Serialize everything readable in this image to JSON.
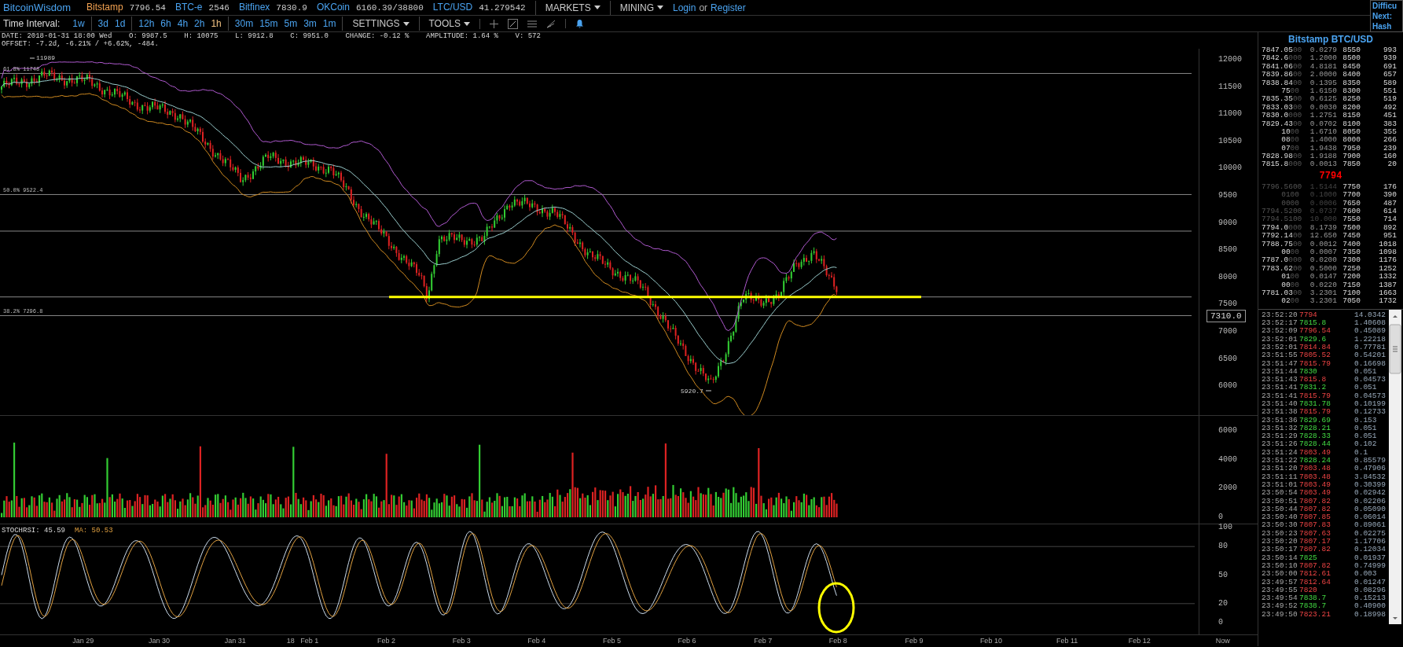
{
  "top_bar": {
    "logo": "BitcoinWisdom",
    "exchanges": [
      {
        "name": "Bitstamp",
        "price": "7796.54",
        "selected": true
      },
      {
        "name": "BTC-e",
        "price": "2546",
        "selected": false
      },
      {
        "name": "Bitfinex",
        "price": "7830.9",
        "selected": false
      },
      {
        "name": "OKCoin",
        "price": "6160.39/38800",
        "selected": false
      },
      {
        "name": "LTC/USD",
        "price": "41.279542",
        "selected": false
      }
    ],
    "menus": [
      "MARKETS",
      "MINING"
    ],
    "login": "Login",
    "or": "or",
    "register": "Register",
    "side_box": [
      "Difficu",
      "Next:",
      "Hash"
    ]
  },
  "toolbar": {
    "label": "Time Interval:",
    "interval_groups": [
      [
        {
          "label": "1w",
          "selected": false
        }
      ],
      [
        {
          "label": "3d",
          "selected": false
        },
        {
          "label": "1d",
          "selected": false
        }
      ],
      [
        {
          "label": "12h",
          "selected": false
        },
        {
          "label": "6h",
          "selected": false
        },
        {
          "label": "4h",
          "selected": false
        },
        {
          "label": "2h",
          "selected": false
        },
        {
          "label": "1h",
          "selected": true
        }
      ],
      [
        {
          "label": "30m",
          "selected": false
        },
        {
          "label": "15m",
          "selected": false
        },
        {
          "label": "5m",
          "selected": false
        },
        {
          "label": "3m",
          "selected": false
        },
        {
          "label": "1m",
          "selected": false
        }
      ]
    ],
    "menus": [
      "SETTINGS",
      "TOOLS"
    ]
  },
  "info_lines": [
    "DATE: 2018-01-31 18:00 Wed    O: 9987.5    H: 10075    L: 9912.8    C: 9951.0    CHANGE: -0.12 %    AMPLITUDE: 1.64 %    V: 572",
    "OFFSET: -7.2d, -6.21% / +6.62%, -484."
  ],
  "price_chart": {
    "fib_levels": [
      "61.8% 11748",
      "50.0% 9522.4",
      "38.2% 7296.8"
    ],
    "annotations": [
      "11989",
      "5920.7"
    ],
    "price_tag": "7310.0",
    "y_ticks": [
      "12000",
      "11500",
      "11000",
      "10500",
      "10000",
      "9500",
      "9000",
      "8500",
      "8000",
      "7500",
      "7000",
      "6500",
      "6000"
    ]
  },
  "volume_chart": {
    "y_ticks": [
      "6000",
      "4000",
      "2000",
      "0"
    ]
  },
  "stoch_chart": {
    "title": "STOCHRSI: 45.59",
    "ma": "MA: 50.53",
    "y_ticks": [
      "100",
      "80",
      "50",
      "20",
      "0"
    ]
  },
  "x_axis": [
    "Jan 29",
    "Jan 30",
    "Jan 31",
    "18",
    "Feb 1",
    "Feb 2",
    "Feb 3",
    "Feb 4",
    "Feb 5",
    "Feb 6",
    "Feb 7",
    "Feb 8",
    "Feb 9",
    "Feb 10",
    "Feb 11",
    "Feb 12",
    "Now"
  ],
  "order_book": {
    "title": "Bitstamp BTC/USD",
    "asks": [
      {
        "price": "7847.05",
        "price_tail": "00",
        "amount": "0.0279",
        "level": "8550",
        "total": "993"
      },
      {
        "price": "7842.6",
        "price_tail": "000",
        "amount": "1.2000",
        "level": "8500",
        "total": "939"
      },
      {
        "price": "7841.06",
        "price_tail": "00",
        "amount": "4.8181",
        "level": "8450",
        "total": "691"
      },
      {
        "price": "7839.86",
        "price_tail": "00",
        "amount": "2.0000",
        "level": "8400",
        "total": "657"
      },
      {
        "price": "7838.84",
        "price_tail": "00",
        "amount": "0.1395",
        "level": "8350",
        "total": "589"
      },
      {
        "price": "75",
        "price_tail": "00",
        "amount": "1.6150",
        "level": "8300",
        "total": "551"
      },
      {
        "price": "7835.35",
        "price_tail": "00",
        "amount": "0.6125",
        "level": "8250",
        "total": "519"
      },
      {
        "price": "7833.03",
        "price_tail": "00",
        "amount": "0.0030",
        "level": "8200",
        "total": "492"
      },
      {
        "price": "7830.0",
        "price_tail": "000",
        "amount": "1.2751",
        "level": "8150",
        "total": "451"
      },
      {
        "price": "7829.43",
        "price_tail": "00",
        "amount": "0.0702",
        "level": "8100",
        "total": "383"
      },
      {
        "price": "10",
        "price_tail": "00",
        "amount": "1.6710",
        "level": "8050",
        "total": "355"
      },
      {
        "price": "08",
        "price_tail": "00",
        "amount": "1.4000",
        "level": "8000",
        "total": "266"
      },
      {
        "price": "07",
        "price_tail": "00",
        "amount": "1.9438",
        "level": "7950",
        "total": "239"
      },
      {
        "price": "7828.98",
        "price_tail": "00",
        "amount": "1.9188",
        "level": "7900",
        "total": "160"
      },
      {
        "price": "7815.8",
        "price_tail": "000",
        "amount": "0.0013",
        "level": "7850",
        "total": "20"
      }
    ],
    "last_price": "7794",
    "bids": [
      {
        "price": "7796.56",
        "price_tail": "00",
        "amount": "1.5144",
        "level": "7750",
        "total": "176",
        "dim": true
      },
      {
        "price": "01",
        "price_tail": "00",
        "amount": "0.1000",
        "level": "7700",
        "total": "390",
        "dim": true
      },
      {
        "price": "00",
        "price_tail": "00",
        "amount": "0.0006",
        "level": "7650",
        "total": "487",
        "dim": true
      },
      {
        "price": "7794.52",
        "price_tail": "00",
        "amount": "0.0737",
        "level": "7600",
        "total": "614",
        "dim": true
      },
      {
        "price": "7794.51",
        "price_tail": "00",
        "amount": "10.000",
        "level": "7550",
        "total": "714",
        "dim": true
      },
      {
        "price": "7794.0",
        "price_tail": "000",
        "amount": "8.1739",
        "level": "7500",
        "total": "892",
        "dim": false
      },
      {
        "price": "7792.14",
        "price_tail": "00",
        "amount": "12.650",
        "level": "7450",
        "total": "951",
        "dim": false
      },
      {
        "price": "7788.75",
        "price_tail": "00",
        "amount": "0.0012",
        "level": "7400",
        "total": "1018",
        "dim": false
      },
      {
        "price": "00",
        "price_tail": "00",
        "amount": "0.0007",
        "level": "7350",
        "total": "1098",
        "dim": false
      },
      {
        "price": "7787.0",
        "price_tail": "000",
        "amount": "0.0200",
        "level": "7300",
        "total": "1176",
        "dim": false
      },
      {
        "price": "7783.62",
        "price_tail": "00",
        "amount": "0.5000",
        "level": "7250",
        "total": "1252",
        "dim": false
      },
      {
        "price": "01",
        "price_tail": "00",
        "amount": "0.0147",
        "level": "7200",
        "total": "1332",
        "dim": false
      },
      {
        "price": "00",
        "price_tail": "00",
        "amount": "0.0220",
        "level": "7150",
        "total": "1387",
        "dim": false
      },
      {
        "price": "7781.03",
        "price_tail": "00",
        "amount": "3.2301",
        "level": "7100",
        "total": "1663",
        "dim": false
      },
      {
        "price": "02",
        "price_tail": "00",
        "amount": "3.2301",
        "level": "7050",
        "total": "1732",
        "dim": false
      }
    ]
  },
  "trades": [
    {
      "time": "23:52:20",
      "price": "7794",
      "amount": "14.0342",
      "buy": false
    },
    {
      "time": "23:52:17",
      "price": "7815.8",
      "amount": "1.40608",
      "buy": true
    },
    {
      "time": "23:52:09",
      "price": "7796.54",
      "amount": "0.45089",
      "buy": false
    },
    {
      "time": "23:52:01",
      "price": "7829.6",
      "amount": "1.22218",
      "buy": true
    },
    {
      "time": "23:52:01",
      "price": "7814.84",
      "amount": "0.77781",
      "buy": false
    },
    {
      "time": "23:51:55",
      "price": "7805.52",
      "amount": "0.54201",
      "buy": false
    },
    {
      "time": "23:51:47",
      "price": "7815.79",
      "amount": "0.16698",
      "buy": false
    },
    {
      "time": "23:51:44",
      "price": "7830",
      "amount": "0.051",
      "buy": true
    },
    {
      "time": "23:51:43",
      "price": "7815.8",
      "amount": "0.04573",
      "buy": false
    },
    {
      "time": "23:51:41",
      "price": "7831.2",
      "amount": "0.051",
      "buy": true
    },
    {
      "time": "23:51:41",
      "price": "7815.79",
      "amount": "0.04573",
      "buy": false
    },
    {
      "time": "23:51:40",
      "price": "7831.78",
      "amount": "0.10199",
      "buy": true
    },
    {
      "time": "23:51:38",
      "price": "7815.79",
      "amount": "0.12733",
      "buy": false
    },
    {
      "time": "23:51:36",
      "price": "7829.69",
      "amount": "0.153",
      "buy": true
    },
    {
      "time": "23:51:32",
      "price": "7828.21",
      "amount": "0.051",
      "buy": true
    },
    {
      "time": "23:51:29",
      "price": "7828.33",
      "amount": "0.051",
      "buy": true
    },
    {
      "time": "23:51:26",
      "price": "7828.44",
      "amount": "0.102",
      "buy": true
    },
    {
      "time": "23:51:24",
      "price": "7803.49",
      "amount": "0.1",
      "buy": false
    },
    {
      "time": "23:51:22",
      "price": "7828.24",
      "amount": "0.85579",
      "buy": true
    },
    {
      "time": "23:51:20",
      "price": "7803.48",
      "amount": "0.47906",
      "buy": false
    },
    {
      "time": "23:51:11",
      "price": "7803.48",
      "amount": "3.84532",
      "buy": false
    },
    {
      "time": "23:51:01",
      "price": "7803.49",
      "amount": "0.30399",
      "buy": false
    },
    {
      "time": "23:50:54",
      "price": "7803.49",
      "amount": "0.02942",
      "buy": false
    },
    {
      "time": "23:50:51",
      "price": "7807.82",
      "amount": "0.02206",
      "buy": false
    },
    {
      "time": "23:50:44",
      "price": "7807.82",
      "amount": "0.05090",
      "buy": false
    },
    {
      "time": "23:50:40",
      "price": "7807.85",
      "amount": "0.06014",
      "buy": false
    },
    {
      "time": "23:50:30",
      "price": "7807.83",
      "amount": "0.89061",
      "buy": false
    },
    {
      "time": "23:50:23",
      "price": "7807.63",
      "amount": "0.02275",
      "buy": false
    },
    {
      "time": "23:50:20",
      "price": "7807.17",
      "amount": "1.17706",
      "buy": false
    },
    {
      "time": "23:50:17",
      "price": "7807.82",
      "amount": "0.12034",
      "buy": false
    },
    {
      "time": "23:50:14",
      "price": "7825",
      "amount": "0.01937",
      "buy": true
    },
    {
      "time": "23:50:10",
      "price": "7807.82",
      "amount": "0.74999",
      "buy": false
    },
    {
      "time": "23:50:00",
      "price": "7812.61",
      "amount": "0.003",
      "buy": false
    },
    {
      "time": "23:49:57",
      "price": "7812.64",
      "amount": "0.01247",
      "buy": false
    },
    {
      "time": "23:49:55",
      "price": "7820",
      "amount": "0.08296",
      "buy": false
    },
    {
      "time": "23:49:54",
      "price": "7838.7",
      "amount": "0.15213",
      "buy": true
    },
    {
      "time": "23:49:52",
      "price": "7838.7",
      "amount": "0.40900",
      "buy": true
    },
    {
      "time": "23:49:50",
      "price": "7823.21",
      "amount": "0.18998",
      "buy": false
    }
  ]
}
